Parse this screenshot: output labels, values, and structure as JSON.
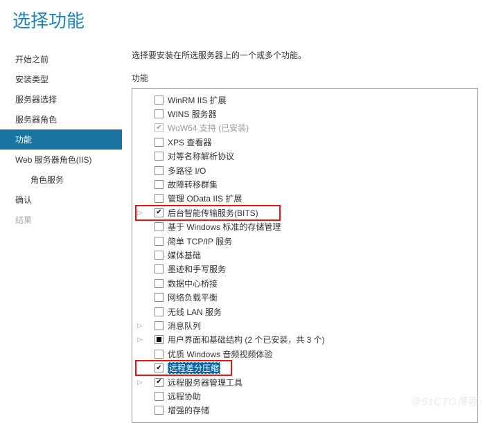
{
  "page_title": "选择功能",
  "sidebar": {
    "items": [
      {
        "label": "开始之前",
        "state": "normal"
      },
      {
        "label": "安装类型",
        "state": "normal"
      },
      {
        "label": "服务器选择",
        "state": "normal"
      },
      {
        "label": "服务器角色",
        "state": "normal"
      },
      {
        "label": "功能",
        "state": "selected"
      },
      {
        "label": "Web 服务器角色(IIS)",
        "state": "normal"
      },
      {
        "label": "角色服务",
        "state": "normal",
        "sub": true
      },
      {
        "label": "确认",
        "state": "normal"
      },
      {
        "label": "结果",
        "state": "disabled"
      }
    ]
  },
  "content": {
    "instruction": "选择要安装在所选服务器上的一个或多个功能。",
    "section_label": "功能",
    "features": [
      {
        "label": "WinRM IIS 扩展",
        "check": "unchecked",
        "indent": 1
      },
      {
        "label": "WINS 服务器",
        "check": "unchecked",
        "indent": 1
      },
      {
        "label": "WoW64 支持 (已安装)",
        "check": "checked-disabled",
        "indent": 1,
        "disabled": true
      },
      {
        "label": "XPS 查看器",
        "check": "unchecked",
        "indent": 1
      },
      {
        "label": "对等名称解析协议",
        "check": "unchecked",
        "indent": 1
      },
      {
        "label": "多路径 I/O",
        "check": "unchecked",
        "indent": 1
      },
      {
        "label": "故障转移群集",
        "check": "unchecked",
        "indent": 1
      },
      {
        "label": "管理 OData IIS 扩展",
        "check": "unchecked",
        "indent": 1
      },
      {
        "label": "后台智能传输服务(BITS)",
        "check": "checked",
        "indent": 1,
        "expandable": true,
        "highlight": "red1"
      },
      {
        "label": "基于 Windows 标准的存储管理",
        "check": "unchecked",
        "indent": 1
      },
      {
        "label": "简单 TCP/IP 服务",
        "check": "unchecked",
        "indent": 1
      },
      {
        "label": "媒体基础",
        "check": "unchecked",
        "indent": 1
      },
      {
        "label": "墨迹和手写服务",
        "check": "unchecked",
        "indent": 1
      },
      {
        "label": "数据中心桥接",
        "check": "unchecked",
        "indent": 1
      },
      {
        "label": "网络负载平衡",
        "check": "unchecked",
        "indent": 1
      },
      {
        "label": "无线 LAN 服务",
        "check": "unchecked",
        "indent": 1
      },
      {
        "label": "消息队列",
        "check": "unchecked",
        "indent": 1,
        "expandable": true
      },
      {
        "label": "用户界面和基础结构 (2 个已安装，共 3 个)",
        "check": "partial",
        "indent": 1,
        "expandable": true
      },
      {
        "label": "优质 Windows 音频视频体验",
        "check": "unchecked",
        "indent": 1
      },
      {
        "label": "远程差分压缩",
        "check": "checked",
        "indent": 1,
        "selected": true,
        "highlight": "red2"
      },
      {
        "label": "远程服务器管理工具",
        "check": "checked",
        "indent": 1,
        "expandable": true
      },
      {
        "label": "远程协助",
        "check": "unchecked",
        "indent": 1
      },
      {
        "label": "增强的存储",
        "check": "unchecked",
        "indent": 1
      }
    ]
  },
  "watermark": "@51CTO博客"
}
